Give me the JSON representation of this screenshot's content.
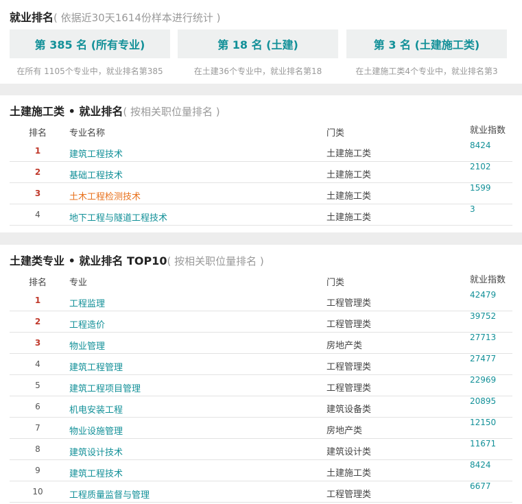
{
  "summary": {
    "title": "就业排名",
    "subtitle": "( 依据近30天1614份样本进行统计 )",
    "boxes": [
      {
        "label": "第 385 名 (所有专业)",
        "note": "在所有 1105个专业中，就业排名第385"
      },
      {
        "label": "第 18 名 (土建)",
        "note": "在土建36个专业中，就业排名第18"
      },
      {
        "label": "第 3 名 (土建施工类)",
        "note": "在土建施工类4个专业中，就业排名第3"
      }
    ]
  },
  "category_table": {
    "title": "土建施工类 • 就业排名",
    "subtitle": "( 按相关职位量排名 )",
    "headers": {
      "rank": "排名",
      "name": "专业名称",
      "category": "门类",
      "index": "就业指数"
    },
    "rows": [
      {
        "rank": "1",
        "name": "建筑工程技术",
        "category": "土建施工类",
        "index": "8424"
      },
      {
        "rank": "2",
        "name": "基础工程技术",
        "category": "土建施工类",
        "index": "2102"
      },
      {
        "rank": "3",
        "name": "土木工程检测技术",
        "category": "土建施工类",
        "index": "1599"
      },
      {
        "rank": "4",
        "name": "地下工程与隧道工程技术",
        "category": "土建施工类",
        "index": "3"
      }
    ]
  },
  "top10_table": {
    "title": "土建类专业 • 就业排名 TOP10",
    "subtitle": "( 按相关职位量排名 )",
    "headers": {
      "rank": "排名",
      "name": "专业",
      "category": "门类",
      "index": "就业指数"
    },
    "rows": [
      {
        "rank": "1",
        "name": "工程监理",
        "category": "工程管理类",
        "index": "42479"
      },
      {
        "rank": "2",
        "name": "工程造价",
        "category": "工程管理类",
        "index": "39752"
      },
      {
        "rank": "3",
        "name": "物业管理",
        "category": "房地产类",
        "index": "27713"
      },
      {
        "rank": "4",
        "name": "建筑工程管理",
        "category": "工程管理类",
        "index": "27477"
      },
      {
        "rank": "5",
        "name": "建筑工程项目管理",
        "category": "工程管理类",
        "index": "22969"
      },
      {
        "rank": "6",
        "name": "机电安装工程",
        "category": "建筑设备类",
        "index": "20895"
      },
      {
        "rank": "7",
        "name": "物业设施管理",
        "category": "房地产类",
        "index": "12150"
      },
      {
        "rank": "8",
        "name": "建筑设计技术",
        "category": "建筑设计类",
        "index": "11671"
      },
      {
        "rank": "9",
        "name": "建筑工程技术",
        "category": "土建施工类",
        "index": "8424"
      },
      {
        "rank": "10",
        "name": "工程质量监督与管理",
        "category": "工程管理类",
        "index": "6677"
      }
    ]
  }
}
